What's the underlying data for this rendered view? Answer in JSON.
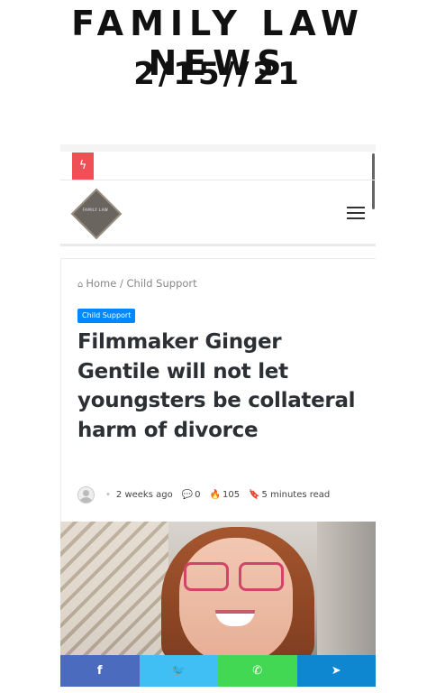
{
  "header": {
    "title": "FAMILY LAW NEWS",
    "date": "2/15//21"
  },
  "site": {
    "logo_text": "FAMILY LAW",
    "flash_icon": "lightning-icon",
    "menu_icon": "hamburger-menu-icon"
  },
  "breadcrumb": {
    "home": "Home",
    "separator": "/",
    "current": "Child Support"
  },
  "article": {
    "category": "Child Support",
    "title": "Filmmaker Ginger Gentile will not let youngsters be collateral harm of divorce",
    "time_ago": "2 weeks ago",
    "comments": "0",
    "views": "105",
    "read_time": "5 minutes read"
  },
  "share": {
    "facebook": "f",
    "twitter": "🐦",
    "whatsapp": "✆",
    "telegram": "➤"
  },
  "colors": {
    "flash": "#ef4f55",
    "badge": "#0088ff",
    "facebook": "#4b6bbf",
    "twitter": "#40bff5",
    "whatsapp": "#43d854",
    "telegram": "#0f87d0"
  }
}
